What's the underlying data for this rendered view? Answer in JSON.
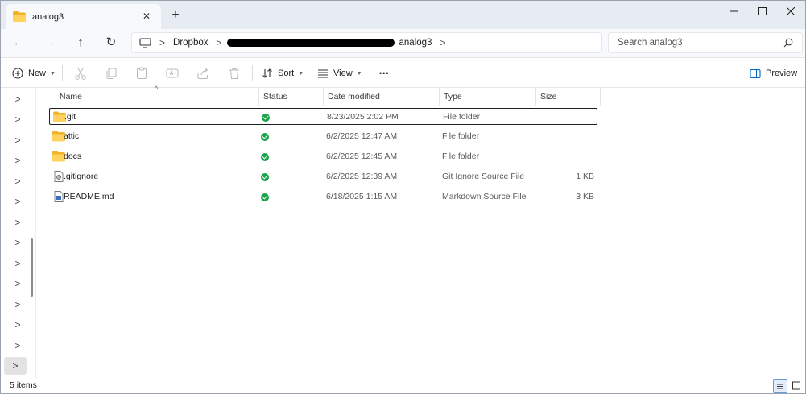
{
  "tab": {
    "title": "analog3",
    "close_glyph": "✕",
    "new_glyph": "+"
  },
  "window_controls": {
    "minimize": "—",
    "maximize": "☐",
    "close": "✕"
  },
  "nav_buttons": {
    "back": "←",
    "forward": "→",
    "up": "↑",
    "refresh": "↻"
  },
  "breadcrumb": {
    "root_icon": "computer-icon",
    "items": [
      "Dropbox",
      "analog3"
    ],
    "sep": ">"
  },
  "search": {
    "placeholder": "Search analog3"
  },
  "toolbar": {
    "new_label": "New",
    "sort_label": "Sort",
    "view_label": "View",
    "more_glyph": "•••",
    "preview_label": "Preview"
  },
  "columns": {
    "name": "Name",
    "status": "Status",
    "date": "Date modified",
    "type": "Type",
    "size": "Size"
  },
  "files": [
    {
      "name": ".git",
      "date": "8/23/2025 2:02 PM",
      "type": "File folder",
      "size": "",
      "kind": "folder"
    },
    {
      "name": "attic",
      "date": "6/2/2025 12:47 AM",
      "type": "File folder",
      "size": "",
      "kind": "folder"
    },
    {
      "name": "docs",
      "date": "6/2/2025 12:45 AM",
      "type": "File folder",
      "size": "",
      "kind": "folder"
    },
    {
      "name": ".gitignore",
      "date": "6/2/2025 12:39 AM",
      "type": "Git Ignore Source File",
      "size": "1 KB",
      "kind": "gear-file"
    },
    {
      "name": "README.md",
      "date": "6/18/2025 1:15 AM",
      "type": "Markdown Source File",
      "size": "3 KB",
      "kind": "doc-file"
    }
  ],
  "nav_chevron": ">",
  "statusbar": {
    "count": "5 items"
  },
  "colors": {
    "accent": "#0067c0",
    "folder": "#f3c14b",
    "synced": "#1aa34a"
  }
}
